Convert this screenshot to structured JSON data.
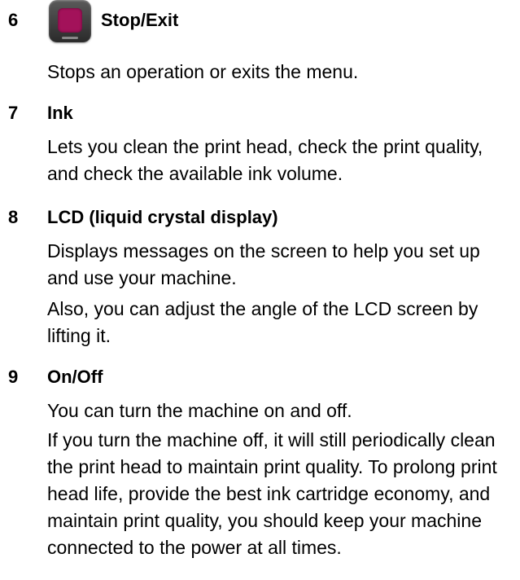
{
  "items": [
    {
      "number": "6",
      "title": "Stop/Exit",
      "icon": "stop-exit-key-icon",
      "paragraphs": [
        "Stops an operation or exits the menu."
      ]
    },
    {
      "number": "7",
      "title": "Ink",
      "paragraphs": [
        "Lets you clean the print head, check the print quality, and check the available ink volume."
      ]
    },
    {
      "number": "8",
      "title": "LCD (liquid crystal display)",
      "paragraphs": [
        "Displays messages on the screen to help you set up and use your machine.",
        "Also, you can adjust the angle of the LCD screen by lifting it."
      ]
    },
    {
      "number": "9",
      "title": "On/Off",
      "paragraphs": [
        "You can turn the machine on and off.",
        "If you turn the machine off, it will still periodically clean the print head to maintain print quality. To prolong print head life, provide the best ink cartridge economy, and maintain print quality, you should keep your machine connected to the power at all times."
      ]
    }
  ],
  "colors": {
    "stop_key_face": "#a3125a",
    "stop_key_body": "#3a3a3a"
  }
}
